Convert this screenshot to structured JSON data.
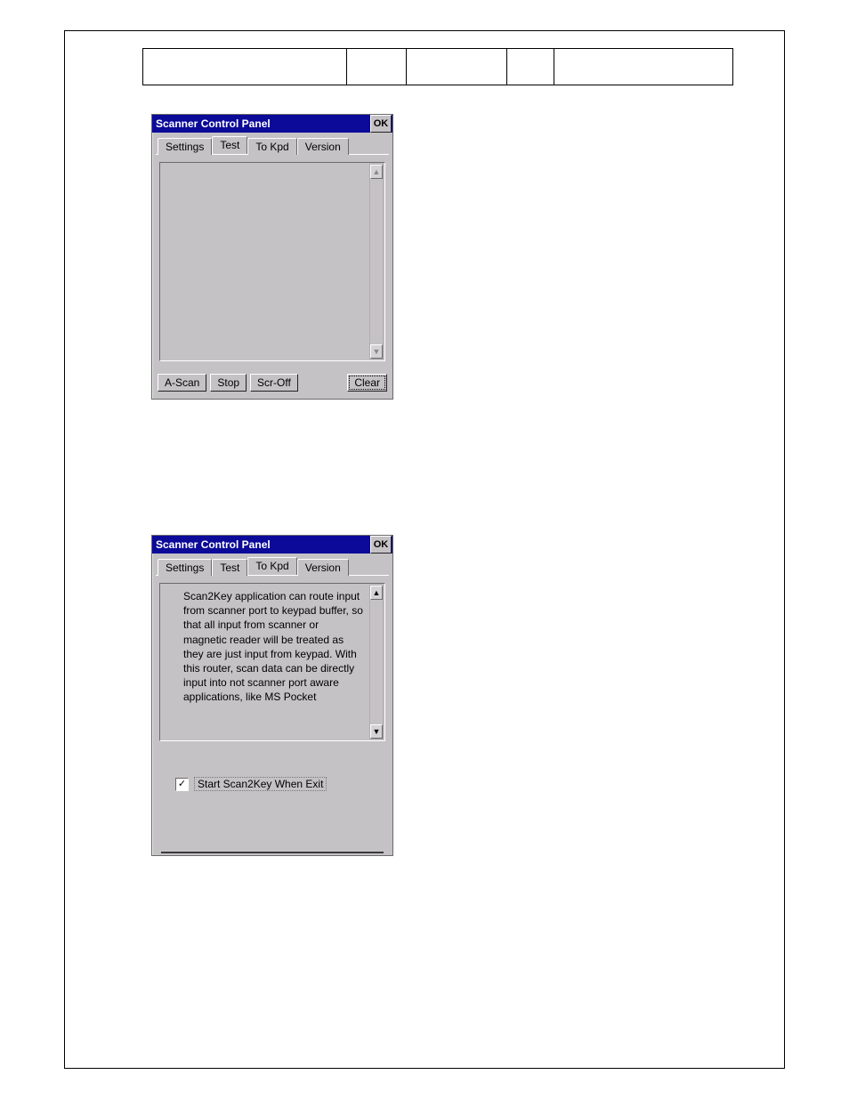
{
  "panel1": {
    "title": "Scanner Control Panel",
    "ok_label": "OK",
    "tabs": {
      "settings": "Settings",
      "test": "Test",
      "to_kpd": "To Kpd",
      "version": "Version",
      "active": "test"
    },
    "buttons": {
      "ascan": "A-Scan",
      "stop": "Stop",
      "scr_off": "Scr-Off",
      "clear": "Clear"
    }
  },
  "panel2": {
    "title": "Scanner Control Panel",
    "ok_label": "OK",
    "tabs": {
      "settings": "Settings",
      "test": "Test",
      "to_kpd": "To Kpd",
      "version": "Version",
      "active": "to_kpd"
    },
    "description": "Scan2Key application can route input from scanner port to keypad buffer, so that all input from scanner or magnetic reader will be treated as they are just input from keypad. With this router, scan data can be directly input into not scanner port aware applications, like MS Pocket",
    "checkbox": {
      "checked": true,
      "label": "Start Scan2Key When Exit"
    }
  },
  "icons": {
    "up_triangle": "▲",
    "down_triangle": "▼",
    "checkmark": "✓"
  }
}
